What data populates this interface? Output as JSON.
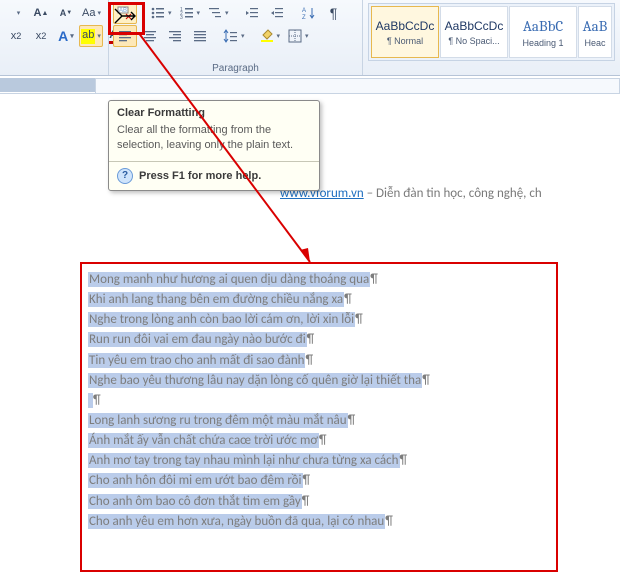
{
  "ribbon": {
    "paragraph_label": "Paragraph"
  },
  "styles": {
    "preview": "AaBbCcDc",
    "preview_big": "AaBbC",
    "preview_cut": "AaB",
    "items": [
      "¶ Normal",
      "¶ No Spaci...",
      "Heading 1",
      "Heac"
    ]
  },
  "tooltip": {
    "title": "Clear Formatting",
    "body": "Clear all the formatting from the selection, leaving only the plain text.",
    "help": "Press F1 for more help."
  },
  "header": {
    "link": "www.vforum.vn",
    "after": " – Diễn đàn tin học, công nghệ, ch"
  },
  "doc": {
    "lines": [
      "Mong manh như hương ai quen dịu dàng thoáng qua",
      "Khi anh lang thang bên em đường chiều nắng xa",
      "Nghe trong lòng anh còn bao lời cám ơn, lời xin lỗi",
      "Run run đôi vai em đau ngày nào bước đi",
      "Tin yêu em trao cho anh mất đi sao đành",
      "Nghe bao yêu thương lâu nay dặn lòng cố quên giờ lại thiết tha",
      "",
      "Long lanh sương ru trong đêm một màu mắt nâu",
      "Ánh mắt ấy vẫn chất chứa caœ trời ước mơ",
      "Anh mơ tay trong tay nhau mình lại như chưa từng xa cách",
      "Cho anh hôn đôi mi em ướt bao đêm rồi",
      "Cho anh ôm bao cô đơn thắt tim em gầy",
      "Cho anh yêu em hơn xưa, ngày buồn đã qua, lại có nhau"
    ]
  }
}
